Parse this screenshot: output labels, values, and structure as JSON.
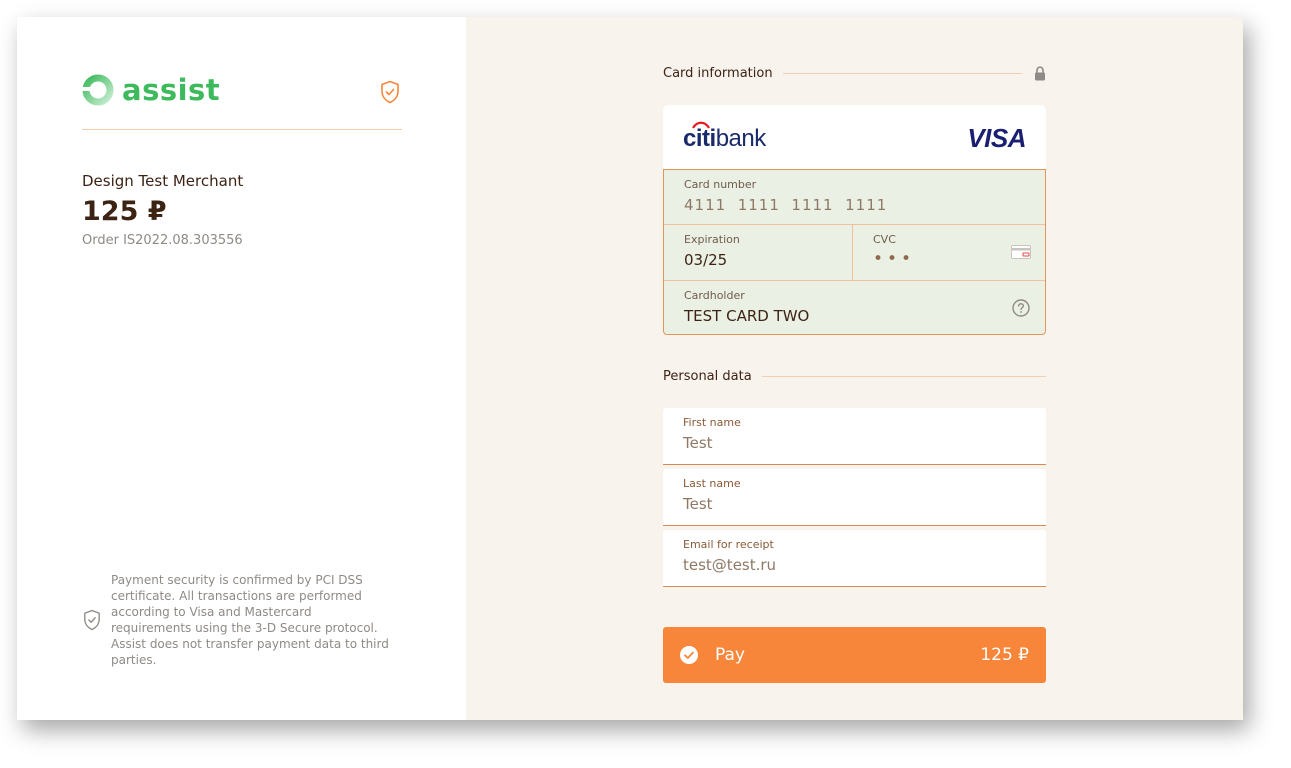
{
  "brand": {
    "name": "assist",
    "logo_color": "#3dba5c",
    "logo_icon": "assist-ring-icon"
  },
  "merchant": {
    "name": "Design Test Merchant",
    "amount": "125 ₽",
    "order": "Order IS2022.08.303556"
  },
  "security_note": "Payment security is confirmed by PCI DSS certificate. All transactions are performed according to Visa and Mastercard requirements using the 3-D Secure protocol. Assist does not transfer payment data to third parties.",
  "card_section": {
    "title": "Card information",
    "bank": {
      "prefix": "citi",
      "suffix": "bank"
    },
    "network": "VISA",
    "fields": {
      "number": {
        "label": "Card number",
        "value": "4111  1111  1111  1111"
      },
      "expiration": {
        "label": "Expiration",
        "value": "03/25"
      },
      "cvc": {
        "label": "CVC",
        "value": "•••"
      },
      "cardholder": {
        "label": "Cardholder",
        "value": "TEST CARD TWO"
      }
    }
  },
  "personal_section": {
    "title": "Personal data",
    "fields": {
      "first_name": {
        "label": "First name",
        "value": "Test"
      },
      "last_name": {
        "label": "Last name",
        "value": "Test"
      },
      "email": {
        "label": "Email for receipt",
        "value": "test@test.ru"
      }
    }
  },
  "pay_button": {
    "label": "Pay",
    "amount": "125 ₽",
    "color": "#f7863a"
  },
  "colors": {
    "accent": "#f7863a",
    "field_bg": "#ebf0e5",
    "panel_bg": "#f9f3ee",
    "text_dark": "#3c2314"
  }
}
